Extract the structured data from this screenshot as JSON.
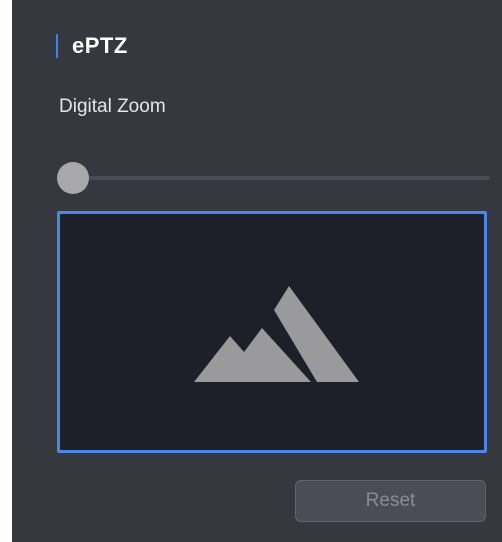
{
  "panel": {
    "title": "ePTZ",
    "accent_color": "#3b82f6"
  },
  "zoom": {
    "label": "Digital Zoom",
    "slider_value": 0,
    "slider_min": 0,
    "slider_max": 1
  },
  "preview": {
    "placeholder_icon": "mountain-icon",
    "selected": true
  },
  "actions": {
    "reset_label": "Reset",
    "reset_enabled": false
  }
}
